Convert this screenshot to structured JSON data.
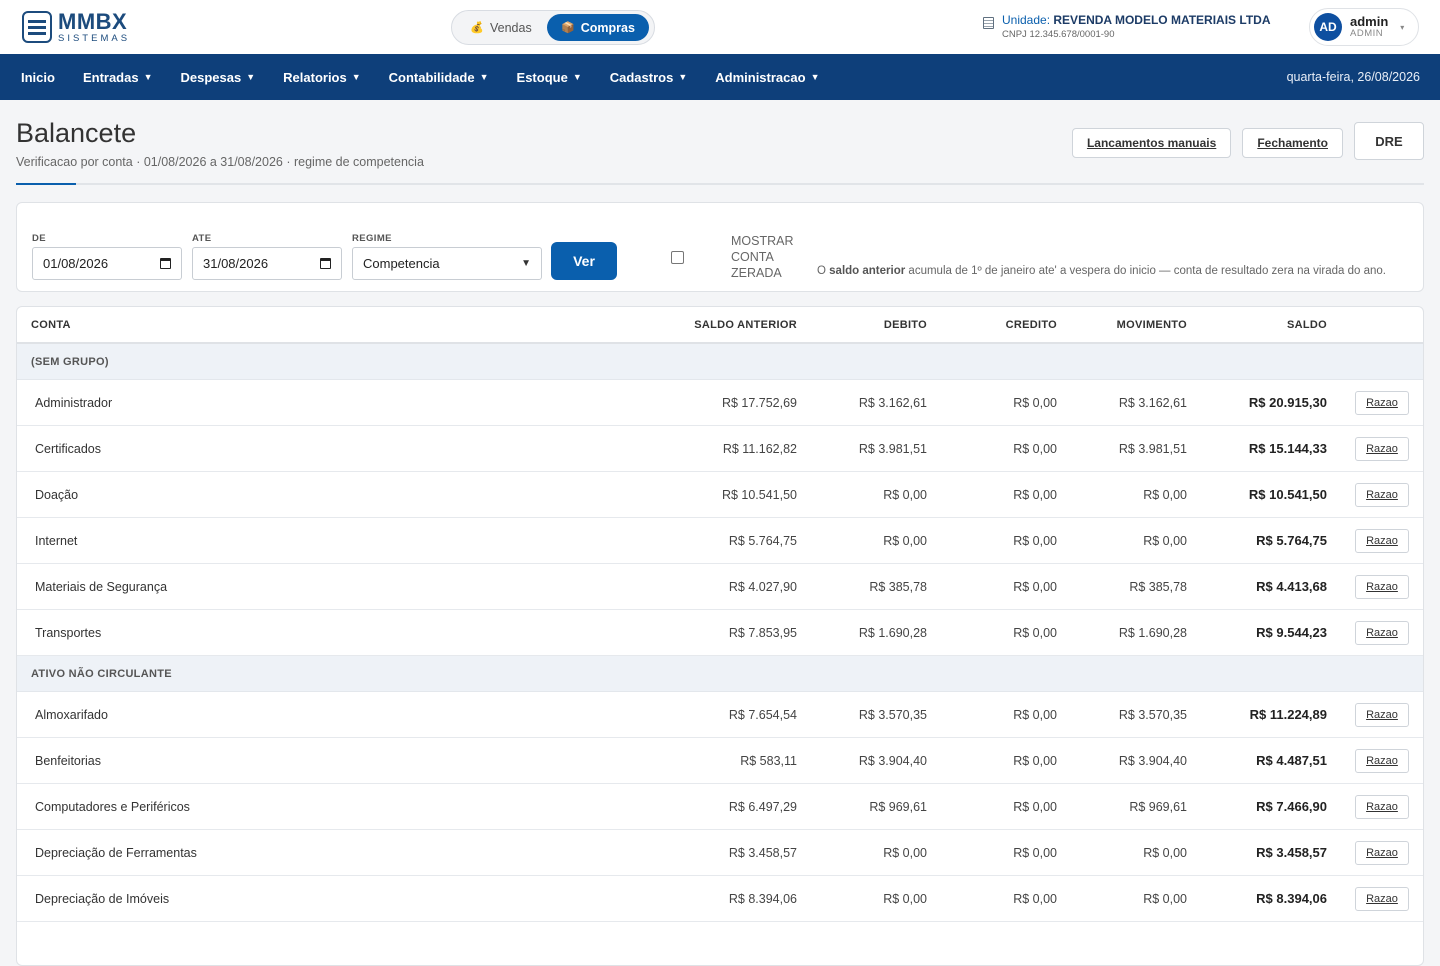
{
  "brand": {
    "name": "MMBX",
    "sub": "SISTEMAS"
  },
  "mode_switch": {
    "vendas": "Vendas",
    "compras": "Compras",
    "vendas_icon": "💰",
    "compras_icon": "📦"
  },
  "unit": {
    "prefix": "Unidade:",
    "name": "REVENDA MODELO MATERIAIS LTDA",
    "cnpj": "CNPJ 12.345.678/0001-90"
  },
  "user": {
    "initials": "AD",
    "name": "admin",
    "role": "ADMIN"
  },
  "nav": {
    "items": [
      "Inicio",
      "Entradas",
      "Despesas",
      "Relatorios",
      "Contabilidade",
      "Estoque",
      "Cadastros",
      "Administracao"
    ],
    "date": "quarta-feira, 26/08/2026"
  },
  "page": {
    "title": "Balancete",
    "subtitle": "Verificacao por conta · 01/08/2026 a 31/08/2026 · regime de competencia",
    "actions": {
      "manual": "Lancamentos manuais",
      "fechamento": "Fechamento",
      "dre": "DRE"
    }
  },
  "filters": {
    "de_label": "DE",
    "de_value": "01/08/2026",
    "ate_label": "ATE",
    "ate_value": "31/08/2026",
    "regime_label": "REGIME",
    "regime_value": "Competencia",
    "ver": "Ver",
    "mostrar_zerada": "MOSTRAR CONTA ZERADA",
    "note_bold": "saldo anterior",
    "note_pre": "O",
    "note_post": "acumula de 1º de janeiro ate' a vespera do inicio — conta de resultado zera na virada do ano."
  },
  "table": {
    "headers": {
      "conta": "CONTA",
      "saldo_anterior": "SALDO ANTERIOR",
      "debito": "DEBITO",
      "credito": "CREDITO",
      "movimento": "MOVIMENTO",
      "saldo": "SALDO"
    },
    "razao_label": "Razao",
    "groups": [
      {
        "name": "(SEM GRUPO)",
        "rows": [
          {
            "conta": "Administrador",
            "anterior": "R$ 17.752,69",
            "debito": "R$ 3.162,61",
            "credito": "R$ 0,00",
            "movimento": "R$ 3.162,61",
            "saldo": "R$ 20.915,30"
          },
          {
            "conta": "Certificados",
            "anterior": "R$ 11.162,82",
            "debito": "R$ 3.981,51",
            "credito": "R$ 0,00",
            "movimento": "R$ 3.981,51",
            "saldo": "R$ 15.144,33"
          },
          {
            "conta": "Doação",
            "anterior": "R$ 10.541,50",
            "debito": "R$ 0,00",
            "credito": "R$ 0,00",
            "movimento": "R$ 0,00",
            "saldo": "R$ 10.541,50"
          },
          {
            "conta": "Internet",
            "anterior": "R$ 5.764,75",
            "debito": "R$ 0,00",
            "credito": "R$ 0,00",
            "movimento": "R$ 0,00",
            "saldo": "R$ 5.764,75"
          },
          {
            "conta": "Materiais de Segurança",
            "anterior": "R$ 4.027,90",
            "debito": "R$ 385,78",
            "credito": "R$ 0,00",
            "movimento": "R$ 385,78",
            "saldo": "R$ 4.413,68"
          },
          {
            "conta": "Transportes",
            "anterior": "R$ 7.853,95",
            "debito": "R$ 1.690,28",
            "credito": "R$ 0,00",
            "movimento": "R$ 1.690,28",
            "saldo": "R$ 9.544,23"
          }
        ]
      },
      {
        "name": "ATIVO NÃO CIRCULANTE",
        "rows": [
          {
            "conta": "Almoxarifado",
            "anterior": "R$ 7.654,54",
            "debito": "R$ 3.570,35",
            "credito": "R$ 0,00",
            "movimento": "R$ 3.570,35",
            "saldo": "R$ 11.224,89"
          },
          {
            "conta": "Benfeitorias",
            "anterior": "R$ 583,11",
            "debito": "R$ 3.904,40",
            "credito": "R$ 0,00",
            "movimento": "R$ 3.904,40",
            "saldo": "R$ 4.487,51"
          },
          {
            "conta": "Computadores e Periféricos",
            "anterior": "R$ 6.497,29",
            "debito": "R$ 969,61",
            "credito": "R$ 0,00",
            "movimento": "R$ 969,61",
            "saldo": "R$ 7.466,90"
          },
          {
            "conta": "Depreciação de Ferramentas",
            "anterior": "R$ 3.458,57",
            "debito": "R$ 0,00",
            "credito": "R$ 0,00",
            "movimento": "R$ 0,00",
            "saldo": "R$ 3.458,57"
          },
          {
            "conta": "Depreciação de Imóveis",
            "anterior": "R$ 8.394,06",
            "debito": "R$ 0,00",
            "credito": "R$ 0,00",
            "movimento": "R$ 0,00",
            "saldo": "R$ 8.394,06"
          }
        ]
      }
    ]
  },
  "colors": {
    "primary": "#0a5fad",
    "nav_bg": "#0e3f7a",
    "brand": "#1c4b7d"
  }
}
